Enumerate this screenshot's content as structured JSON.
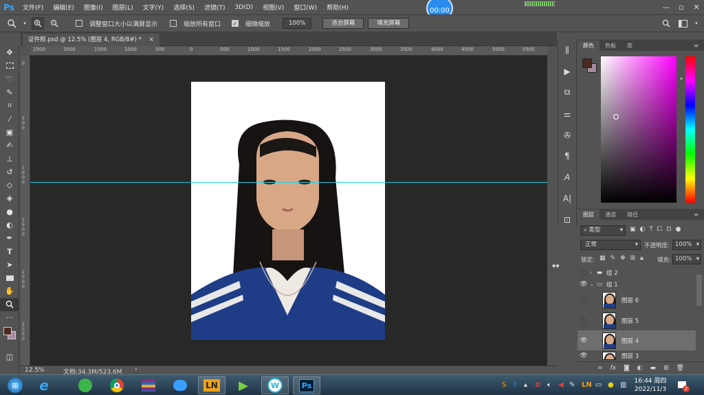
{
  "app": {
    "logo": "Ps"
  },
  "menu": [
    "文件(F)",
    "编辑(E)",
    "图像(I)",
    "图层(L)",
    "文字(Y)",
    "选择(S)",
    "滤镜(T)",
    "3D(D)",
    "视图(V)",
    "窗口(W)",
    "帮助(H)"
  ],
  "window_controls": {
    "minimize": "—",
    "maximize": "▫",
    "close": "✕"
  },
  "timer": "00:00",
  "options_bar": {
    "resize_windows_label": "调整窗口大小以满屏显示",
    "resize_windows_checked": false,
    "zoom_all_label": "缩放所有窗口",
    "zoom_all_checked": false,
    "scrubby_zoom_label": "细微缩放",
    "scrubby_zoom_checked": true,
    "zoom_value": "100%",
    "fit_screen": "适合屏幕",
    "fill_screen": "填充屏幕"
  },
  "document": {
    "tab_title": "证件照.psd @ 12.5% (图层 4, RGB/8#) *",
    "close": "×"
  },
  "ruler_top": [
    "2500",
    "2000",
    "1500",
    "1000",
    "500",
    "0",
    "500",
    "1000",
    "1500",
    "2000",
    "2500",
    "3000",
    "3500",
    "4000",
    "4500",
    "5000",
    "5500"
  ],
  "ruler_left": [
    "0",
    "5\n0\n0",
    "1\n0\n0\n0",
    "1\n5\n0\n0",
    "2\n0\n0\n0",
    "2\n5\n0\n0"
  ],
  "status": {
    "zoom": "12.5%",
    "doc_info": "文档:34.3M/523.6M",
    "arrow": "›"
  },
  "color_panel": {
    "tabs": [
      "颜色",
      "色板",
      "库"
    ],
    "foreground": "#4a2a1e",
    "background": "#a88a9e"
  },
  "layers_panel": {
    "tabs": [
      "图层",
      "通道",
      "路径"
    ],
    "filter_label": "类型",
    "blend_mode": "正常",
    "opacity_label": "不透明度:",
    "opacity_value": "100%",
    "lock_label": "锁定:",
    "fill_label": "填充:",
    "fill_value": "100%",
    "groups": [
      {
        "name": "组 2",
        "visible": false
      },
      {
        "name": "组 1",
        "visible": true
      }
    ],
    "layers": [
      {
        "name": "图层 6",
        "visible": false,
        "selected": false
      },
      {
        "name": "图层 5",
        "visible": false,
        "selected": false
      },
      {
        "name": "图层 4",
        "visible": true,
        "selected": true
      },
      {
        "name": "图层 3",
        "visible": true,
        "selected": false
      }
    ],
    "footer_icons": [
      "link-icon",
      "fx-icon",
      "mask-icon",
      "adjustment-icon",
      "folder-icon",
      "new-layer-icon",
      "trash-icon"
    ]
  },
  "taskbar": {
    "clock_time": "16:44 周四",
    "clock_date": "2022/11/3",
    "apps": [
      "start",
      "ie",
      "360",
      "chrome",
      "winrar",
      "baidu-netdisk",
      "ln",
      "media",
      "wps",
      "ps"
    ],
    "ln_label": "LN",
    "ps_label": "Ps",
    "notification_count": "2"
  },
  "colors": {
    "accent": "#31a8ff",
    "guide": "#1ad1e6",
    "timer": "#2a8cf0"
  }
}
